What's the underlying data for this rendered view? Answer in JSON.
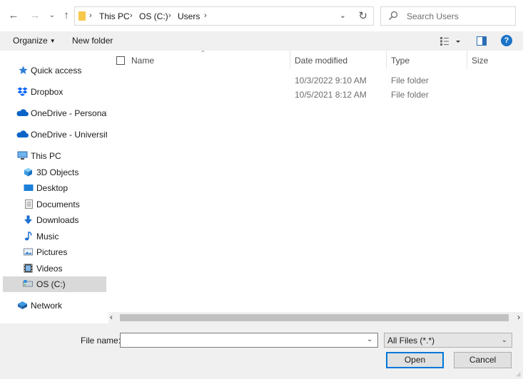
{
  "address_bar": {
    "breadcrumbs": [
      "This PC",
      "OS (C:)",
      "Users"
    ],
    "search_placeholder": "Search Users"
  },
  "toolbar": {
    "organize_label": "Organize",
    "new_folder_label": "New folder",
    "help_label": "?"
  },
  "nav_pane": {
    "quick_access": "Quick access",
    "dropbox": "Dropbox",
    "onedrive_personal": "OneDrive - Personal",
    "onedrive_university": "OneDrive - University",
    "this_pc": "This PC",
    "objects_3d": "3D Objects",
    "desktop": "Desktop",
    "documents": "Documents",
    "downloads": "Downloads",
    "music": "Music",
    "pictures": "Pictures",
    "videos": "Videos",
    "os_c": "OS (C:)",
    "network": "Network"
  },
  "file_list": {
    "columns": {
      "name": "Name",
      "date_modified": "Date modified",
      "type": "Type",
      "size": "Size"
    },
    "rows": [
      {
        "name": "",
        "date_modified": "10/3/2022 9:10 AM",
        "type": "File folder",
        "size": ""
      },
      {
        "name": "",
        "date_modified": "10/5/2021 8:12 AM",
        "type": "File folder",
        "size": ""
      }
    ]
  },
  "bottom": {
    "file_name_label": "File name:",
    "file_name_value": "",
    "file_type_selected": "All Files (*.*)",
    "open_label": "Open",
    "cancel_label": "Cancel"
  },
  "colors": {
    "accent": "#0078d7",
    "help_icon": "#1a73c8",
    "folder": "#f6c94a"
  }
}
